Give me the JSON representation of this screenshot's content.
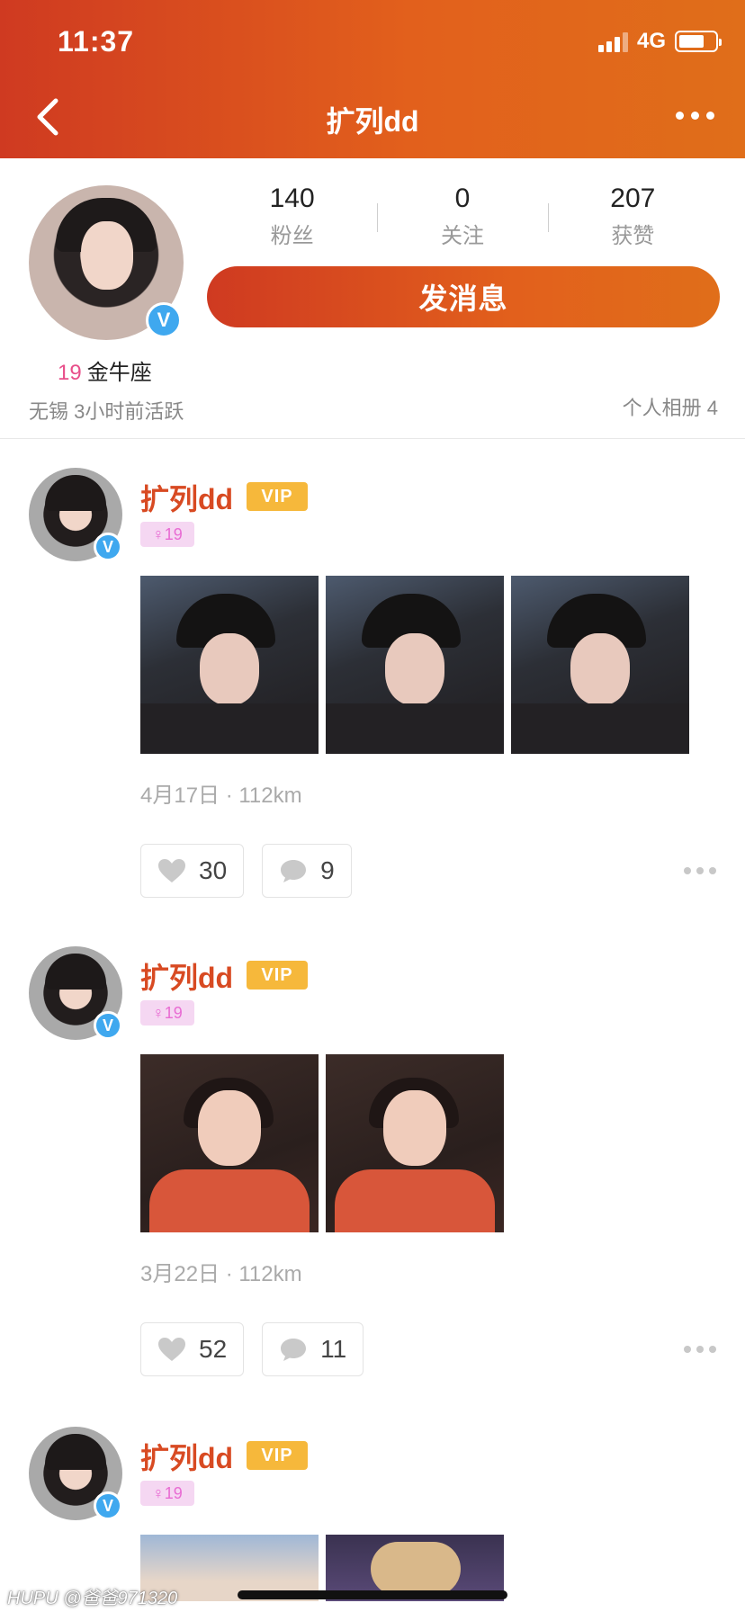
{
  "status_bar": {
    "time": "11:37",
    "network": "4G"
  },
  "header": {
    "title": "扩列dd"
  },
  "profile": {
    "stats": [
      {
        "value": "140",
        "label": "粉丝"
      },
      {
        "value": "0",
        "label": "关注"
      },
      {
        "value": "207",
        "label": "获赞"
      }
    ],
    "message_button": "发消息",
    "age": "19",
    "zodiac": "金牛座",
    "location_activity": "无锡 3小时前活跃",
    "album": "个人相册 4",
    "verified_badge": "V"
  },
  "posts": [
    {
      "name": "扩列dd",
      "vip": "VIP",
      "gender_age": "♀19",
      "meta": "4月17日 · 112km",
      "likes": "30",
      "comments": "9"
    },
    {
      "name": "扩列dd",
      "vip": "VIP",
      "gender_age": "♀19",
      "meta": "3月22日 · 112km",
      "likes": "52",
      "comments": "11"
    },
    {
      "name": "扩列dd",
      "vip": "VIP",
      "gender_age": "♀19"
    }
  ],
  "watermark": "HUPU @爸爸971320",
  "colors": {
    "accent": "#d84a22",
    "vip": "#f6b83b",
    "verified": "#3fa8ef",
    "age": "#e84f8a"
  }
}
